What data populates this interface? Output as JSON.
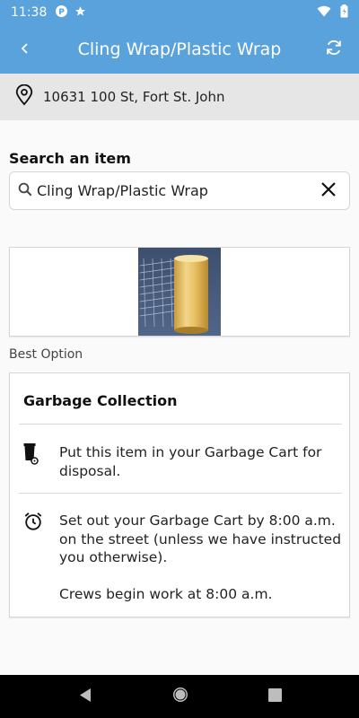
{
  "status_bar": {
    "time": "11:38",
    "icons": [
      "parking-icon",
      "star-icon",
      "wifi-icon",
      "battery-icon"
    ]
  },
  "app_bar": {
    "title": "Cling Wrap/Plastic Wrap",
    "icons": [
      "back-arrow-icon",
      "refresh-icon"
    ]
  },
  "location": {
    "address": "10631 100 St, Fort St. John",
    "icon": "location-pin-icon"
  },
  "search": {
    "label": "Search an item",
    "value": "Cling Wrap/Plastic Wrap",
    "icons": [
      "search-icon",
      "clear-icon"
    ]
  },
  "product": {
    "image": "plastic-wrap-roll-photo"
  },
  "best_option_label": "Best Option",
  "card": {
    "title": "Garbage Collection",
    "rows": [
      {
        "icon": "garbage-cart-icon",
        "text": "Put this item in your Garbage Cart for disposal."
      },
      {
        "icon": "alarm-clock-icon",
        "text": "Set out your Garbage Cart by 8:00 a.m. on the street (unless we have instructed you otherwise).",
        "text2": "Crews begin work at 8:00 a.m."
      }
    ]
  },
  "colors": {
    "header": "#5aa2dc",
    "location_bar": "#e6e6e6",
    "nav_bar": "#000000"
  },
  "nav_bar": {
    "icons": [
      "nav-back-icon",
      "nav-home-icon",
      "nav-recents-icon"
    ]
  }
}
